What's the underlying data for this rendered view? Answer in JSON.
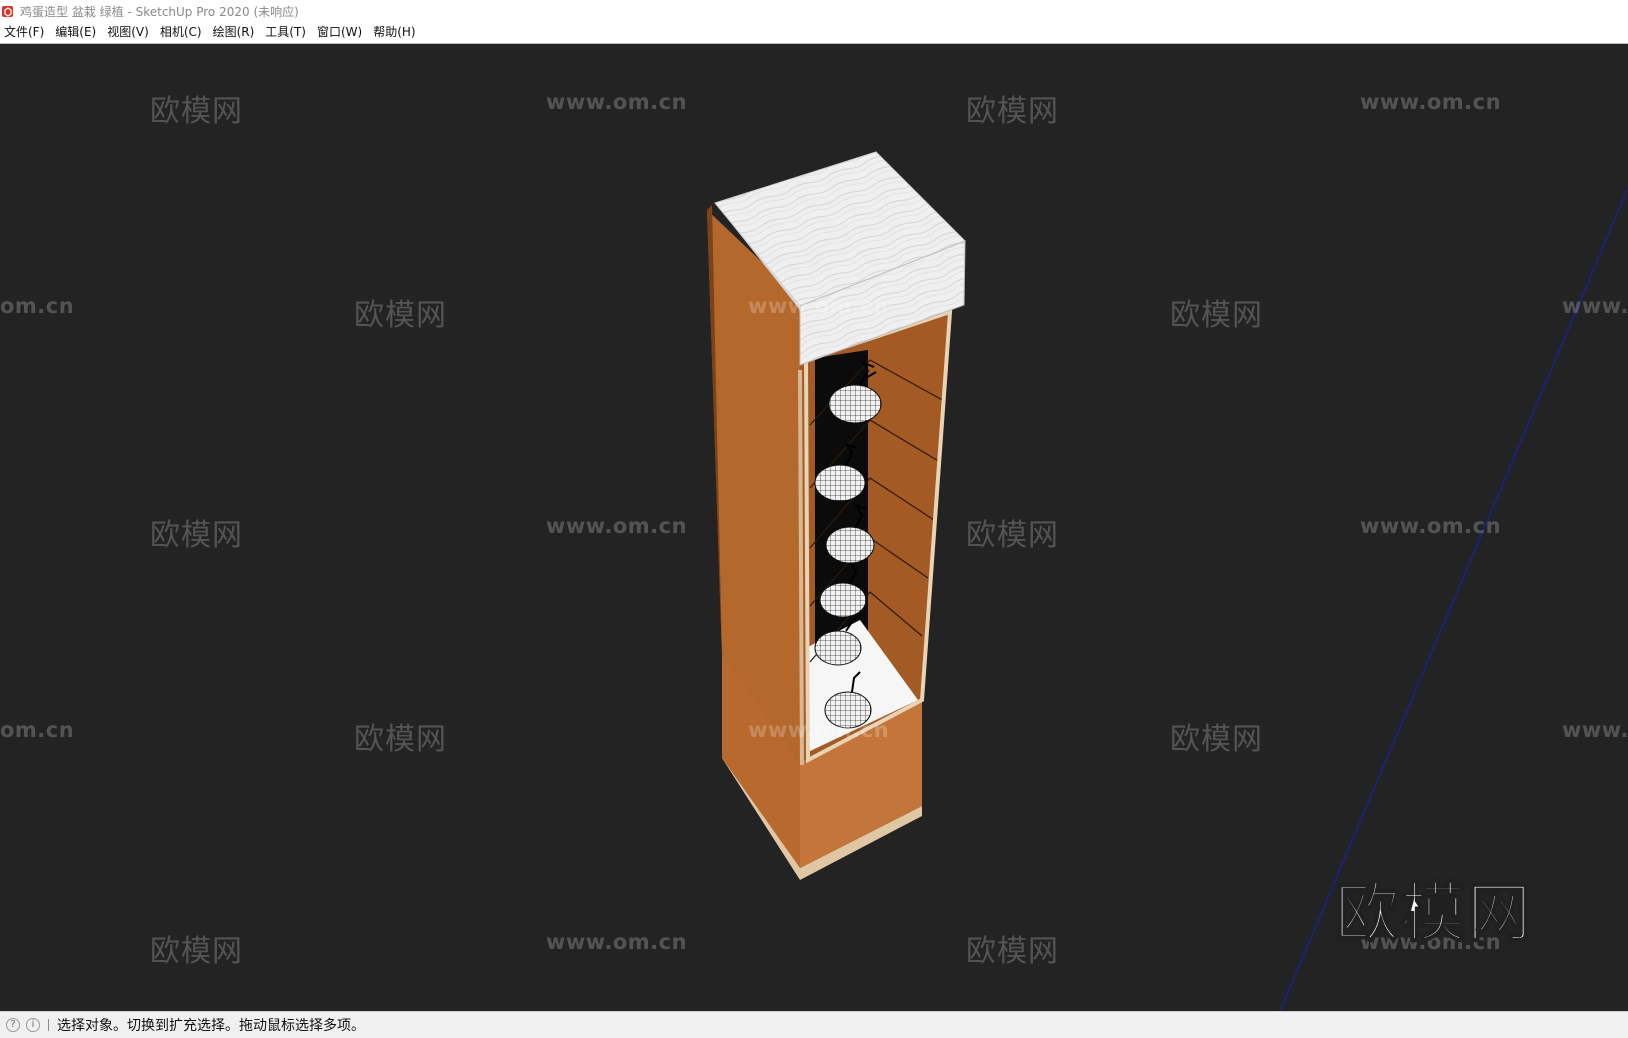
{
  "window": {
    "title": "鸡蛋造型 盆栽 绿植 - SketchUp Pro 2020 (未响应)",
    "icon": "sketchup-logo-icon"
  },
  "menubar": {
    "items": [
      {
        "label": "文件(F)"
      },
      {
        "label": "编辑(E)"
      },
      {
        "label": "视图(V)"
      },
      {
        "label": "相机(C)"
      },
      {
        "label": "绘图(R)"
      },
      {
        "label": "工具(T)"
      },
      {
        "label": "窗口(W)"
      },
      {
        "label": "帮助(H)"
      }
    ]
  },
  "watermarks": {
    "brand": "欧模网",
    "url": "www.om.cn",
    "url_partial": "om.cn",
    "url_partial_right": "www."
  },
  "statusbar": {
    "icons": [
      "geolocation-icon",
      "info-icon"
    ],
    "message": "选择对象。切换到扩充选择。拖动鼠标选择多项。"
  },
  "colors": {
    "viewport_bg": "#232323",
    "cabinet_wood": "#b5682c",
    "cabinet_wood_dark": "#8a4c1f",
    "top_white": "#e8e8e8",
    "blue_axis": "#1e1e8c"
  }
}
